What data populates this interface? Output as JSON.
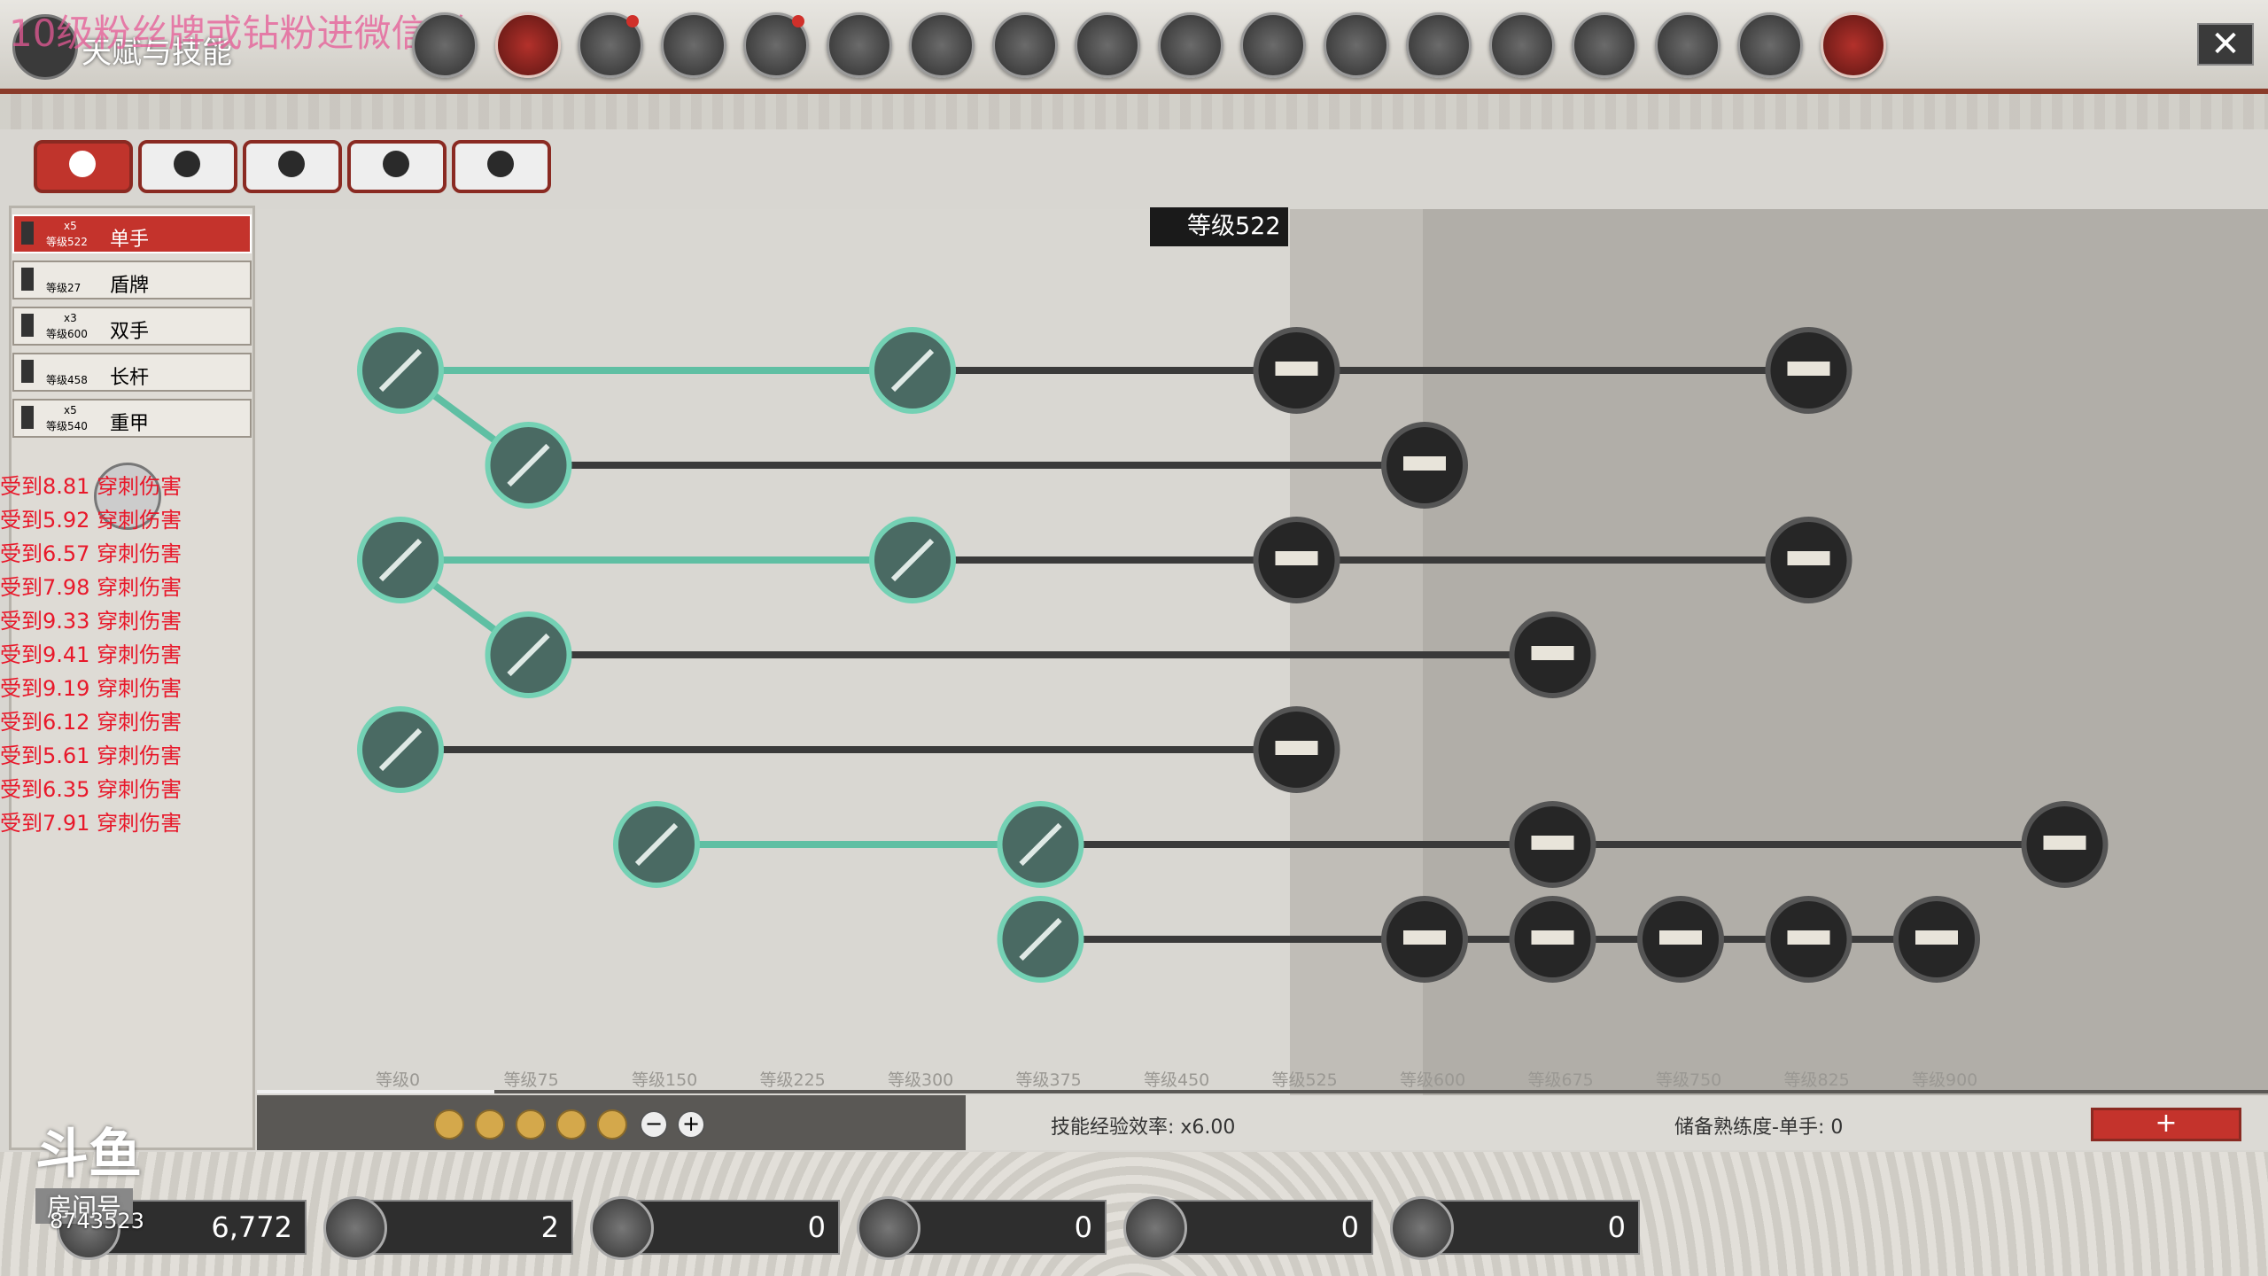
{
  "app": {
    "title": "天赋与技能",
    "watermark": "10级粉丝牌或钻粉进微信群"
  },
  "top_icons": [
    {
      "name": "portrait-icon",
      "active": false,
      "dot": false
    },
    {
      "name": "network-icon",
      "active": true,
      "dot": false
    },
    {
      "name": "bag-icon",
      "active": false,
      "dot": true
    },
    {
      "name": "shield-emblem-icon",
      "active": false,
      "dot": false
    },
    {
      "name": "party-icon",
      "active": false,
      "dot": true
    },
    {
      "name": "horse-icon",
      "active": false,
      "dot": false
    },
    {
      "name": "coin-icon",
      "active": false,
      "dot": false
    },
    {
      "name": "beast-icon",
      "active": false,
      "dot": false
    },
    {
      "name": "face-icon",
      "active": false,
      "dot": false
    },
    {
      "name": "scroll-icon",
      "active": false,
      "dot": false
    },
    {
      "name": "map-icon",
      "active": false,
      "dot": false
    },
    {
      "name": "quest-icon",
      "active": false,
      "dot": false
    },
    {
      "name": "book-icon",
      "active": false,
      "dot": false
    },
    {
      "name": "card-icon",
      "active": false,
      "dot": false
    },
    {
      "name": "ranking-icon",
      "active": false,
      "dot": false
    },
    {
      "name": "altar-icon",
      "active": false,
      "dot": false
    },
    {
      "name": "faction-icon",
      "active": false,
      "dot": false
    },
    {
      "name": "library-icon",
      "active": true,
      "dot": false
    }
  ],
  "close_label": "✕",
  "sub_tabs": [
    {
      "name": "weapon-tab-icon",
      "active": true
    },
    {
      "name": "boot-tab-icon",
      "active": false
    },
    {
      "name": "heart-tab-icon",
      "active": false
    },
    {
      "name": "rider-tab-icon",
      "active": false
    },
    {
      "name": "tag-tab-icon",
      "active": false
    }
  ],
  "weapons": [
    {
      "label": "单手",
      "level": "等级522",
      "mult": "x5",
      "active": true
    },
    {
      "label": "盾牌",
      "level": "等级27",
      "mult": "",
      "active": false
    },
    {
      "label": "双手",
      "level": "等级600",
      "mult": "x3",
      "active": false
    },
    {
      "label": "长杆",
      "level": "等级458",
      "mult": "",
      "active": false
    },
    {
      "label": "重甲",
      "level": "等级540",
      "mult": "x5",
      "active": false
    }
  ],
  "damage_log": [
    "受到8.81 穿刺伤害",
    "受到5.92 穿刺伤害",
    "受到6.57 穿刺伤害",
    "受到7.98 穿刺伤害",
    "受到9.33 穿刺伤害",
    "受到9.41 穿刺伤害",
    "受到9.19 穿刺伤害",
    "受到6.12 穿刺伤害",
    "受到5.61 穿刺伤害",
    "受到6.35 穿刺伤害",
    "受到7.91 穿刺伤害"
  ],
  "level_badge": "等级522",
  "axis_labels": [
    "等级0",
    "等级75",
    "等级150",
    "等级225",
    "等级300",
    "等级375",
    "等级450",
    "等级525",
    "等级600",
    "等级675",
    "等级750",
    "等级825",
    "等级900"
  ],
  "skill_tree": {
    "current_level": 522,
    "nodes": [
      {
        "id": "r1a",
        "level": 0,
        "row": 0,
        "unlocked": true
      },
      {
        "id": "r1b",
        "level": 300,
        "row": 0,
        "unlocked": true
      },
      {
        "id": "r1c",
        "level": 525,
        "row": 0,
        "unlocked": false
      },
      {
        "id": "r1d",
        "level": 825,
        "row": 0,
        "unlocked": false
      },
      {
        "id": "r2a",
        "level": 75,
        "row": 1,
        "unlocked": true
      },
      {
        "id": "r2b",
        "level": 600,
        "row": 1,
        "unlocked": false
      },
      {
        "id": "r3a",
        "level": 0,
        "row": 2,
        "unlocked": true
      },
      {
        "id": "r3b",
        "level": 300,
        "row": 2,
        "unlocked": true
      },
      {
        "id": "r3c",
        "level": 525,
        "row": 2,
        "unlocked": false
      },
      {
        "id": "r3d",
        "level": 825,
        "row": 2,
        "unlocked": false
      },
      {
        "id": "r4a",
        "level": 75,
        "row": 3,
        "unlocked": true
      },
      {
        "id": "r4b",
        "level": 675,
        "row": 3,
        "unlocked": false
      },
      {
        "id": "r5a",
        "level": 0,
        "row": 4,
        "unlocked": true
      },
      {
        "id": "r5b",
        "level": 525,
        "row": 4,
        "unlocked": false
      },
      {
        "id": "r6a",
        "level": 150,
        "row": 5,
        "unlocked": true
      },
      {
        "id": "r6b",
        "level": 375,
        "row": 5,
        "unlocked": true
      },
      {
        "id": "r6c",
        "level": 675,
        "row": 5,
        "unlocked": false
      },
      {
        "id": "r6d",
        "level": 975,
        "row": 5,
        "unlocked": false
      },
      {
        "id": "r7a",
        "level": 375,
        "row": 6,
        "unlocked": true
      },
      {
        "id": "r7b",
        "level": 600,
        "row": 6,
        "unlocked": false
      },
      {
        "id": "r7c",
        "level": 675,
        "row": 6,
        "unlocked": false
      },
      {
        "id": "r7d",
        "level": 750,
        "row": 6,
        "unlocked": false
      },
      {
        "id": "r7e",
        "level": 825,
        "row": 6,
        "unlocked": false
      },
      {
        "id": "r7f",
        "level": 900,
        "row": 6,
        "unlocked": false
      }
    ],
    "edges": [
      [
        "r1a",
        "r1b",
        true
      ],
      [
        "r1b",
        "r1c",
        false
      ],
      [
        "r1c",
        "r1d",
        false
      ],
      [
        "r1a",
        "r2a",
        true
      ],
      [
        "r2a",
        "r2b",
        false
      ],
      [
        "r3a",
        "r3b",
        true
      ],
      [
        "r3b",
        "r3c",
        false
      ],
      [
        "r3c",
        "r3d",
        false
      ],
      [
        "r3a",
        "r4a",
        true
      ],
      [
        "r4a",
        "r4b",
        false
      ],
      [
        "r5a",
        "r5b",
        false
      ],
      [
        "r6a",
        "r6b",
        true
      ],
      [
        "r6b",
        "r6c",
        false
      ],
      [
        "r6c",
        "r6d",
        false
      ],
      [
        "r7a",
        "r7b",
        false
      ],
      [
        "r7b",
        "r7c",
        false
      ],
      [
        "r7c",
        "r7d",
        false
      ],
      [
        "r7d",
        "r7e",
        false
      ],
      [
        "r7e",
        "r7f",
        false
      ]
    ]
  },
  "efficiency_label": "技能经验效率: x6.00",
  "reserve_label": "储备熟练度-单手: 0",
  "plus_label": "+",
  "minus_btn": "−",
  "add_btn": "+",
  "currencies": [
    {
      "name": "gold-icon",
      "value": "6,772"
    },
    {
      "name": "hammer-icon",
      "value": "2"
    },
    {
      "name": "medal-icon",
      "value": "0"
    },
    {
      "name": "gems-icon",
      "value": "0"
    },
    {
      "name": "refresh-icon",
      "value": "0"
    },
    {
      "name": "chest-icon",
      "value": "0"
    }
  ],
  "room_id": "8743523",
  "douyu": {
    "logo": "斗鱼",
    "sub": "房间号"
  },
  "colors": {
    "accent": "#c4332c",
    "unlocked_line": "#5fbfa3",
    "locked_line": "#3a3a3a",
    "damage_text": "#e8182a"
  }
}
